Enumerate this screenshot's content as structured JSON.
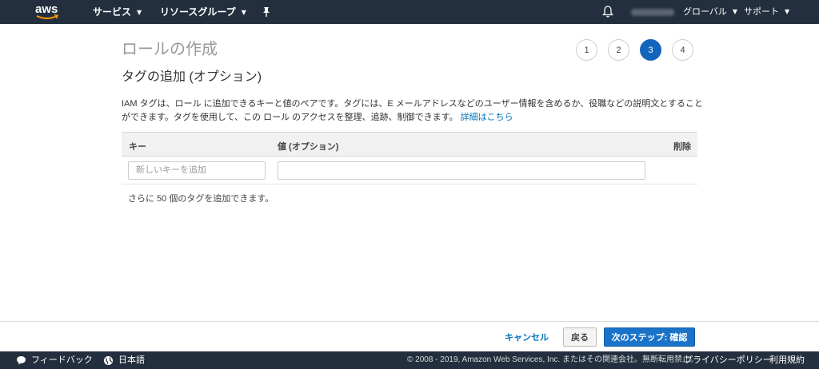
{
  "topnav": {
    "logo_text": "aws",
    "services_label": "サービス",
    "resource_groups_label": "リソースグループ",
    "region_label": "グローバル",
    "support_label": "サポート"
  },
  "wizard": {
    "page_title": "ロールの作成",
    "steps": [
      "1",
      "2",
      "3",
      "4"
    ],
    "current_step": "3",
    "section_title": "タグの追加 (オプション)",
    "description": "IAM タグは、ロール に追加できるキーと値のペアです。タグには、E メールアドレスなどのユーザー情報を含めるか、役職などの説明文とすることができます。タグを使用して、この ロール のアクセスを整理、追跡、制御できます。",
    "learn_more": "詳細はこちら"
  },
  "tag_table": {
    "columns": {
      "key": "キー",
      "value": "値 (オプション)",
      "delete": "削除"
    },
    "key_placeholder": "新しいキーを追加",
    "value_placeholder": "",
    "remaining_text": "さらに 50 個のタグを追加できます。"
  },
  "actions": {
    "cancel": "キャンセル",
    "back": "戻る",
    "next": "次のステップ: 確認"
  },
  "footer": {
    "feedback": "フィードバック",
    "language": "日本語",
    "copyright": "© 2008 - 2019, Amazon Web Services, Inc. またはその関連会社。無断転用禁止。",
    "privacy": "プライバシーポリシー",
    "terms": "利用規約"
  },
  "colors": {
    "nav_bg": "#232f3e",
    "primary": "#1a73c8",
    "link": "#0073bb",
    "logo_smile": "#ff9900"
  }
}
